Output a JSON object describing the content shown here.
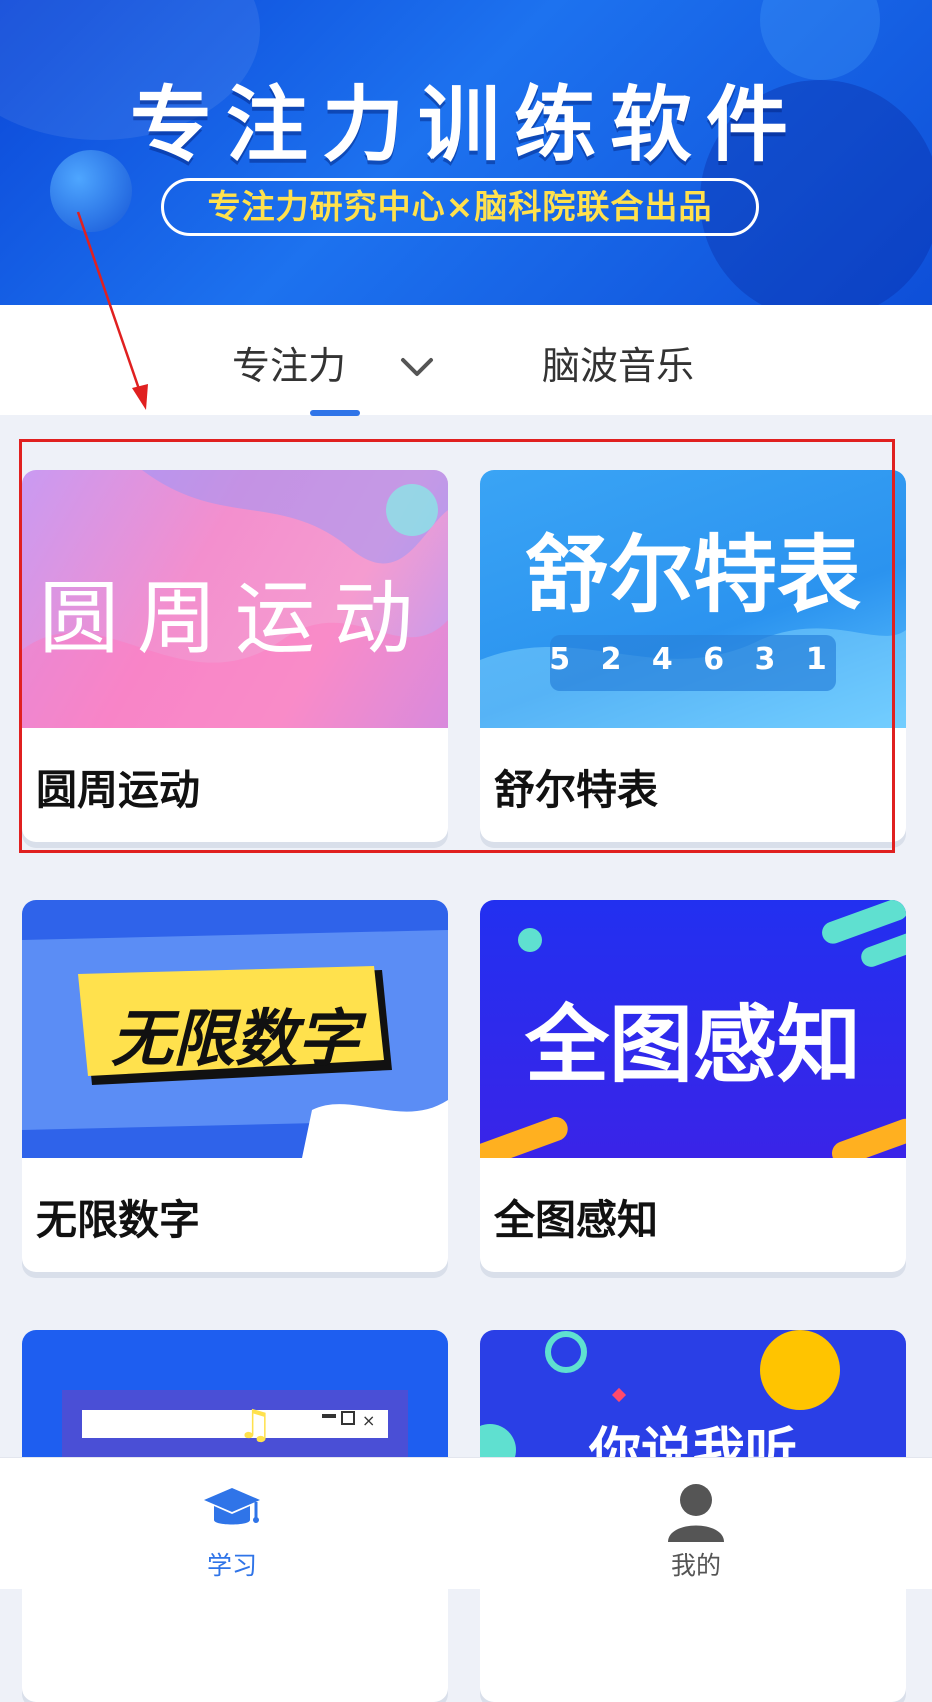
{
  "banner": {
    "title": "专注力训练软件",
    "subtitle": "专注力研究中心×脑科院联合出品"
  },
  "tabs": [
    {
      "label": "专注力",
      "active": true
    },
    {
      "label": "脑波音乐",
      "active": false
    }
  ],
  "cards": [
    {
      "label": "圆周运动",
      "image_text": "圆周运动"
    },
    {
      "label": "舒尔特表",
      "image_text": "舒尔特表",
      "image_digits": "5 2 4 6 3 1"
    },
    {
      "label": "无限数字",
      "image_text": "无限数字"
    },
    {
      "label": "全图感知",
      "image_text": "全图感知"
    },
    {
      "label": "",
      "image_text": ""
    },
    {
      "label": "",
      "image_text": "你说我听"
    }
  ],
  "bottom_nav": [
    {
      "label": "学习",
      "icon": "graduation-cap-icon",
      "active": true
    },
    {
      "label": "我的",
      "icon": "user-icon",
      "active": false
    }
  ],
  "colors": {
    "accent": "#2f74e8",
    "highlight_box": "#e02020",
    "subtitle_yellow": "#ffe14d"
  }
}
